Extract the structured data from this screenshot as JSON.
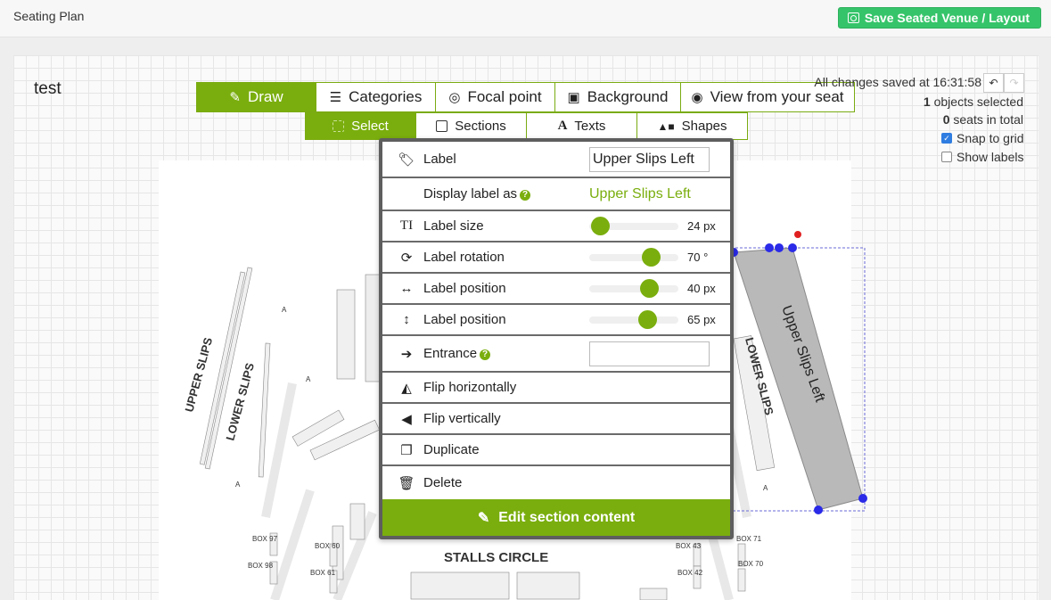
{
  "app": {
    "title": "Seating Plan",
    "save_label": "Save Seated Venue / Layout"
  },
  "venue": {
    "name": "test"
  },
  "toolbar": {
    "main": [
      {
        "label": "Draw",
        "icon": "pencil-icon",
        "active": true
      },
      {
        "label": "Categories",
        "icon": "list-icon",
        "active": false
      },
      {
        "label": "Focal point",
        "icon": "target-icon",
        "active": false
      },
      {
        "label": "Background",
        "icon": "image-icon",
        "active": false
      },
      {
        "label": "View from your seat",
        "icon": "camera-icon",
        "active": false
      }
    ],
    "sub": [
      {
        "label": "Select",
        "icon": "select-icon",
        "active": true
      },
      {
        "label": "Sections",
        "icon": "square-icon",
        "active": false
      },
      {
        "label": "Texts",
        "icon": "text-icon",
        "active": false
      },
      {
        "label": "Shapes",
        "icon": "shapes-icon",
        "active": false
      }
    ]
  },
  "status": {
    "saved_text": "All changes saved at 16:31:58",
    "objects_count": "1",
    "objects_text": "objects selected",
    "seats_count": "0",
    "seats_text": "seats in total",
    "snap_label": "Snap to grid",
    "snap_checked": true,
    "labels_label": "Show labels",
    "labels_checked": false
  },
  "popup": {
    "label_title": "Label",
    "label_value": "Upper Slips Left",
    "display_title": "Display label as",
    "display_value": "Upper Slips Left",
    "size_title": "Label size",
    "size_value": 24,
    "size_text": "24 px",
    "rotation_title": "Label rotation",
    "rotation_value": 70,
    "rotation_text": "70 °",
    "posx_title": "Label position",
    "posx_value": 40,
    "posx_text": "40 px",
    "posy_title": "Label position",
    "posy_value": 65,
    "posy_text": "65 px",
    "entrance_title": "Entrance",
    "entrance_value": "",
    "flip_h": "Flip horizontally",
    "flip_v": "Flip vertically",
    "duplicate": "Duplicate",
    "delete": "Delete",
    "edit_button": "Edit section content"
  },
  "plan": {
    "selected_section_label": "Upper Slips Left",
    "upper_slips": "UPPER SLIPS",
    "lower_slips": "LOWER SLIPS",
    "stalls_circle": "STALLS CIRCLE",
    "boxes": [
      "BOX 97",
      "BOX 98",
      "BOX 60",
      "BOX 61",
      "BOX 43",
      "BOX 42",
      "BOX 71",
      "BOX 70"
    ],
    "row_letters_a": "A",
    "colors": {
      "section_fill": "#b9b9b9",
      "handle": "#2a2ae8",
      "rotate_handle": "#e02020"
    }
  }
}
